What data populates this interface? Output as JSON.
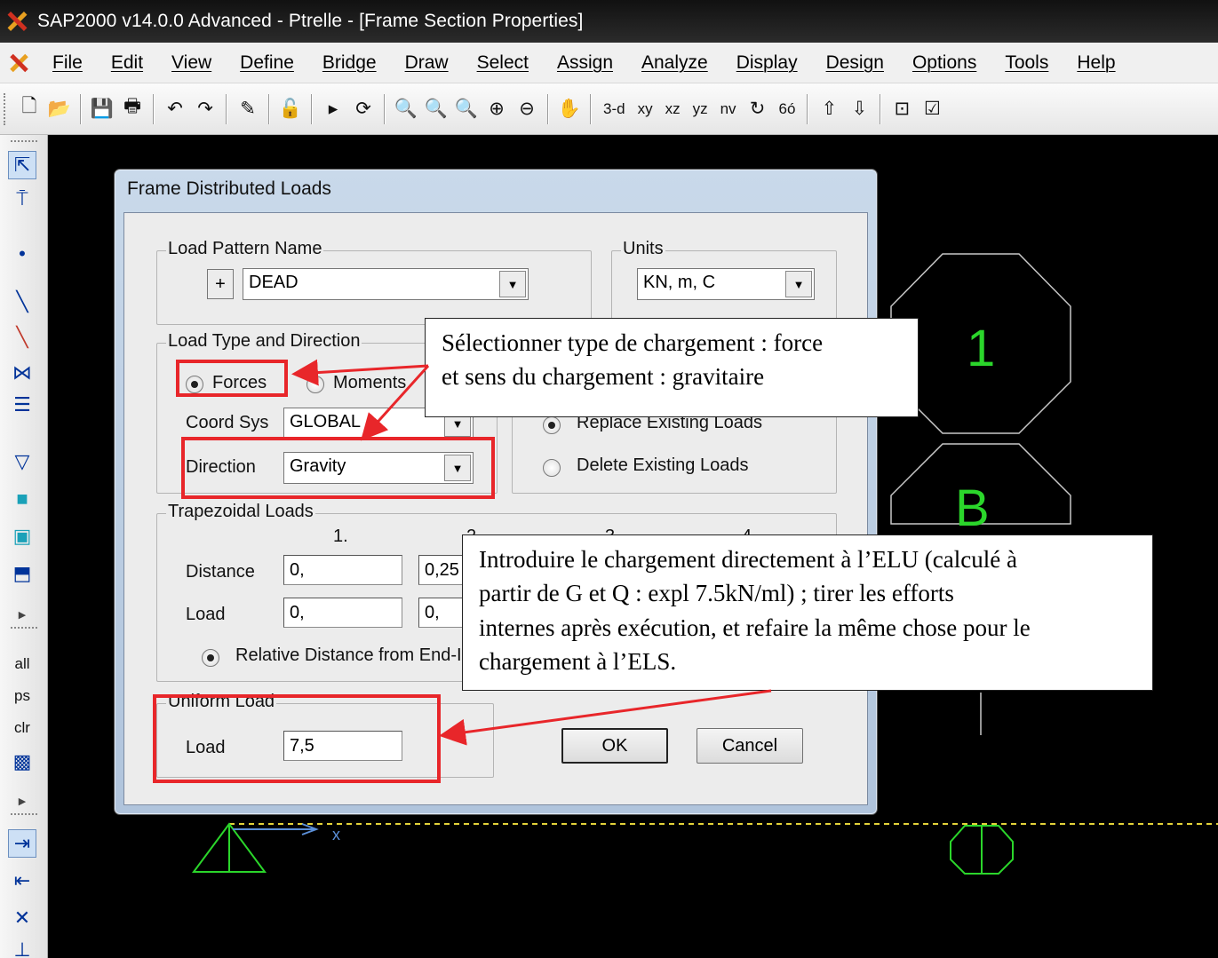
{
  "window": {
    "title": "SAP2000 v14.0.0 Advanced  - Ptrelle - [Frame Section Properties]"
  },
  "menu": [
    "File",
    "Edit",
    "View",
    "Define",
    "Bridge",
    "Draw",
    "Select",
    "Assign",
    "Analyze",
    "Display",
    "Design",
    "Options",
    "Tools",
    "Help"
  ],
  "toolbar": {
    "view_3d": "3-d",
    "view_xy": "xy",
    "view_xz": "xz",
    "view_yz": "yz",
    "view_nv": "nv",
    "view_66": "6ó"
  },
  "sidebar": {
    "all": "all",
    "ps": "ps",
    "clr": "clr"
  },
  "canvas": {
    "grid_label_1": "1",
    "grid_label_b": "B"
  },
  "dialog": {
    "title": "Frame Distributed Loads",
    "load_pattern": {
      "label": "Load Pattern Name",
      "plus": "+",
      "value": "DEAD"
    },
    "units": {
      "label": "Units",
      "value": "KN, m, C"
    },
    "load_type": {
      "label": "Load Type and Direction",
      "forces": "Forces",
      "moments": "Moments",
      "coord_sys_label": "Coord Sys",
      "coord_sys_value": "GLOBAL",
      "direction_label": "Direction",
      "direction_value": "Gravity"
    },
    "options": {
      "replace": "Replace Existing Loads",
      "delete": "Delete Existing Loads"
    },
    "trapezoidal": {
      "label": "Trapezoidal Loads",
      "col1": "1.",
      "col2": "2.",
      "col3": "3.",
      "col4": "4.",
      "distance_label": "Distance",
      "load_label": "Load",
      "distance_1": "0,",
      "distance_2": "0,25",
      "load_1": "0,",
      "load_2": "0,",
      "relative": "Relative Distance from End-I"
    },
    "uniform": {
      "label": "Uniform Load",
      "load_label": "Load",
      "load_value": "7,5"
    },
    "ok": "OK",
    "cancel": "Cancel"
  },
  "annotations": {
    "callout_1": [
      "Sélectionner type de chargement : force",
      "et sens du chargement : gravitaire"
    ],
    "callout_2": [
      "Introduire le chargement directement à l’ELU (calculé à",
      "partir de G et Q : expl 7.5kN/ml) ; tirer les efforts",
      "internes après exécution, et refaire la même chose pour le",
      "chargement à l’ELS."
    ]
  },
  "colors": {
    "highlight": "#e8262a",
    "canvas_bg": "#000000",
    "structure": "#c8c8c8",
    "label_green": "#2bd62b",
    "axis_dash": "#e3d23a"
  }
}
